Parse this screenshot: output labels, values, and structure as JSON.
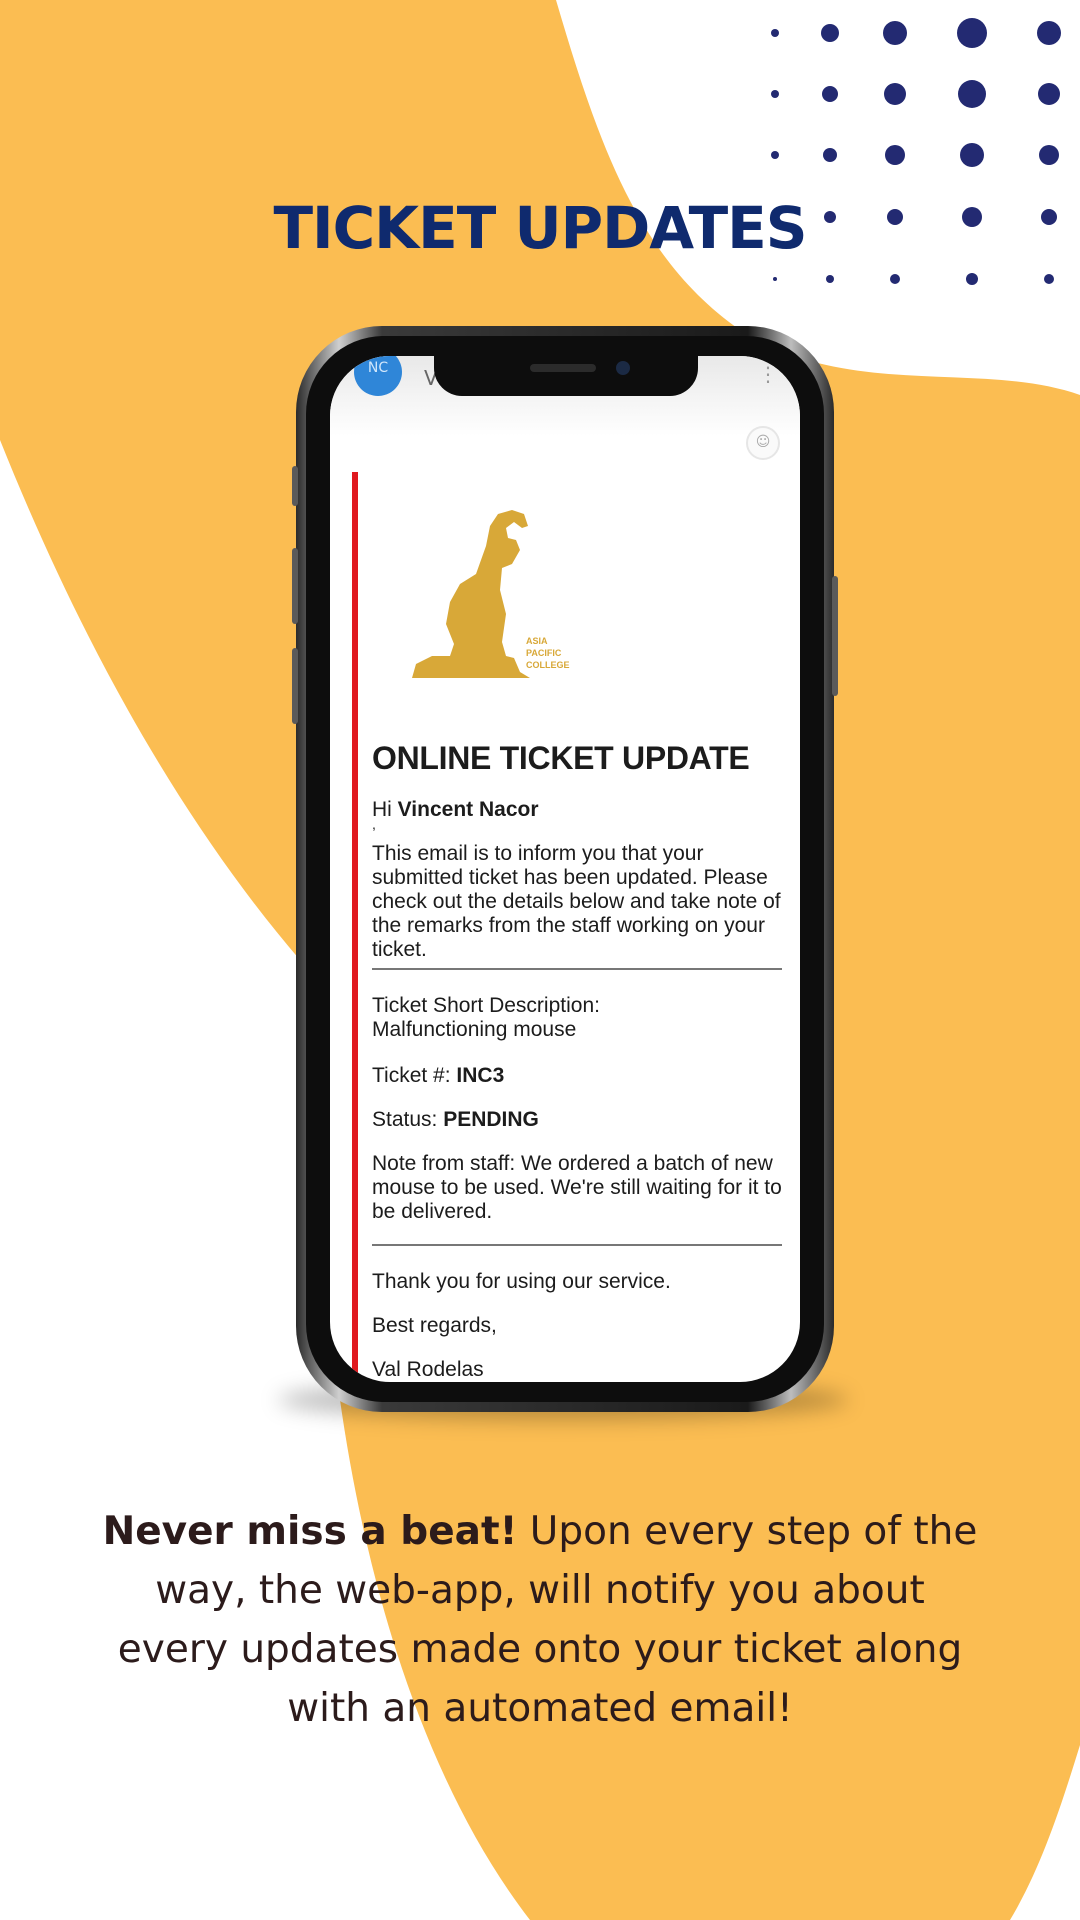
{
  "page": {
    "title": "TICKET UPDATES",
    "caption": {
      "lead": "Never miss a beat!",
      "body": " Upon every step of the way, the web-app, will notify you about every updates made onto your ticket along with an automated email!"
    }
  },
  "colors": {
    "blob": "#fbbd52",
    "title": "#0f2a6e",
    "dots": "#232a72",
    "caption": "#2c1b1b",
    "accent_bar": "#e0191f",
    "logo": "#d8a838"
  },
  "phone": {
    "status": {
      "avatar_initials": "NC",
      "sender_initial": "V"
    },
    "logo_text": [
      "ASIA",
      "PACIFIC",
      "COLLEGE"
    ],
    "email": {
      "heading": "ONLINE TICKET UPDATE",
      "greeting_prefix": "Hi ",
      "recipient": "Vincent Nacor",
      "comma": ",",
      "intro": "This email is to inform you that your submitted ticket has been updated. Please check out the details below and take note of the remarks from the staff working on your ticket.",
      "short_desc_label": "Ticket Short Description:",
      "short_desc_value": "Malfunctioning mouse",
      "ticket_label": "Ticket #: ",
      "ticket_number": "INC3",
      "status_label": "Status: ",
      "status_value": "PENDING",
      "note": "Note from staff: We ordered a batch of new mouse to be used. We're still waiting for it to be delivered.",
      "thanks": "Thank you for using our service.",
      "regards": "Best regards,",
      "signature": "Val Rodelas"
    }
  }
}
